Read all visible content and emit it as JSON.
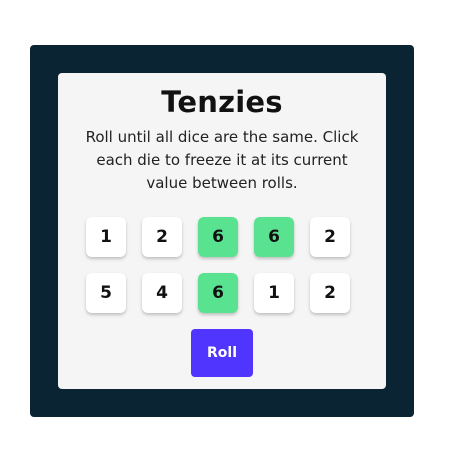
{
  "game": {
    "title": "Tenzies",
    "instructions": "Roll until all dice are the same. Click each die to freeze it at its current value between rolls.",
    "roll_label": "Roll",
    "dice": [
      {
        "value": "1",
        "held": false
      },
      {
        "value": "2",
        "held": false
      },
      {
        "value": "6",
        "held": true
      },
      {
        "value": "6",
        "held": true
      },
      {
        "value": "2",
        "held": false
      },
      {
        "value": "5",
        "held": false
      },
      {
        "value": "4",
        "held": false
      },
      {
        "value": "6",
        "held": true
      },
      {
        "value": "1",
        "held": false
      },
      {
        "value": "2",
        "held": false
      }
    ]
  },
  "colors": {
    "frame": "#0b2434",
    "card": "#f5f5f5",
    "die": "#ffffff",
    "held_die": "#59e391",
    "roll_button": "#5035ff"
  }
}
